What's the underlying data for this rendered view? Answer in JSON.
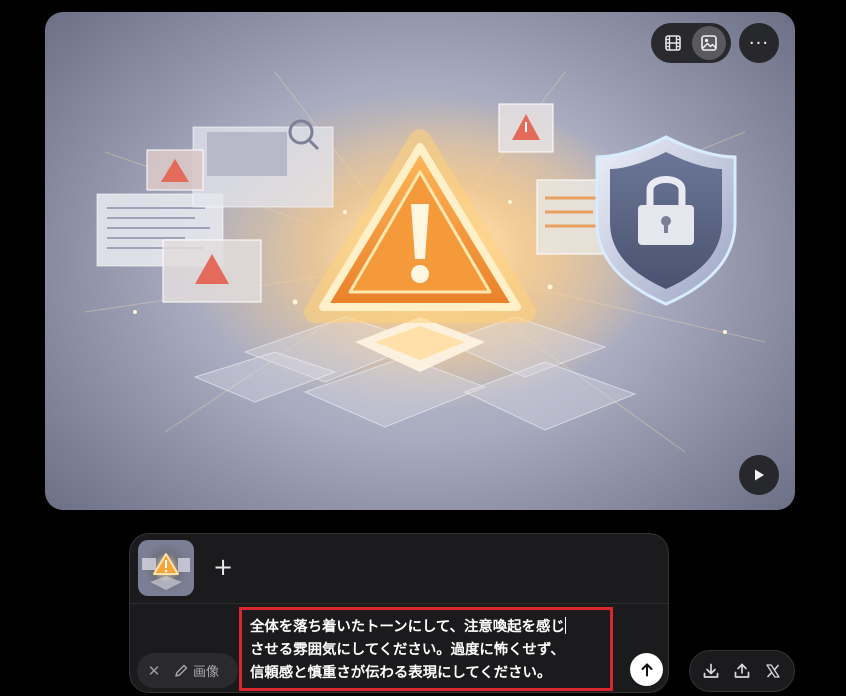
{
  "image_viewer": {
    "view_modes": [
      {
        "name": "video",
        "icon": "film-icon",
        "active": false
      },
      {
        "name": "image",
        "icon": "image-icon",
        "active": true
      }
    ],
    "more_icon": "more-horizontal-icon",
    "more_glyph": "···",
    "play_icon": "play-icon"
  },
  "composer": {
    "attachment_icon": "warning-thumbnail",
    "add_glyph": "+",
    "prompt_lines": [
      "全体を落ち着いたトーンにして、注意喚起を感じ",
      "させる雰囲気にしてください。過度に怖くせず、",
      "信頼感と慎重さが伝わる表現にしてください。"
    ],
    "tool_chip": {
      "clear_glyph": "✕",
      "edit_icon": "pencil-icon",
      "label": "画像"
    },
    "send_icon": "arrow-up-icon"
  },
  "actions": [
    {
      "name": "download",
      "icon": "download-icon"
    },
    {
      "name": "share",
      "icon": "share-icon"
    },
    {
      "name": "x-post",
      "icon": "x-logo-icon"
    }
  ],
  "colors": {
    "highlight_border": "#d8262c",
    "warning_orange": "#f6a33a",
    "background": "#000000"
  }
}
